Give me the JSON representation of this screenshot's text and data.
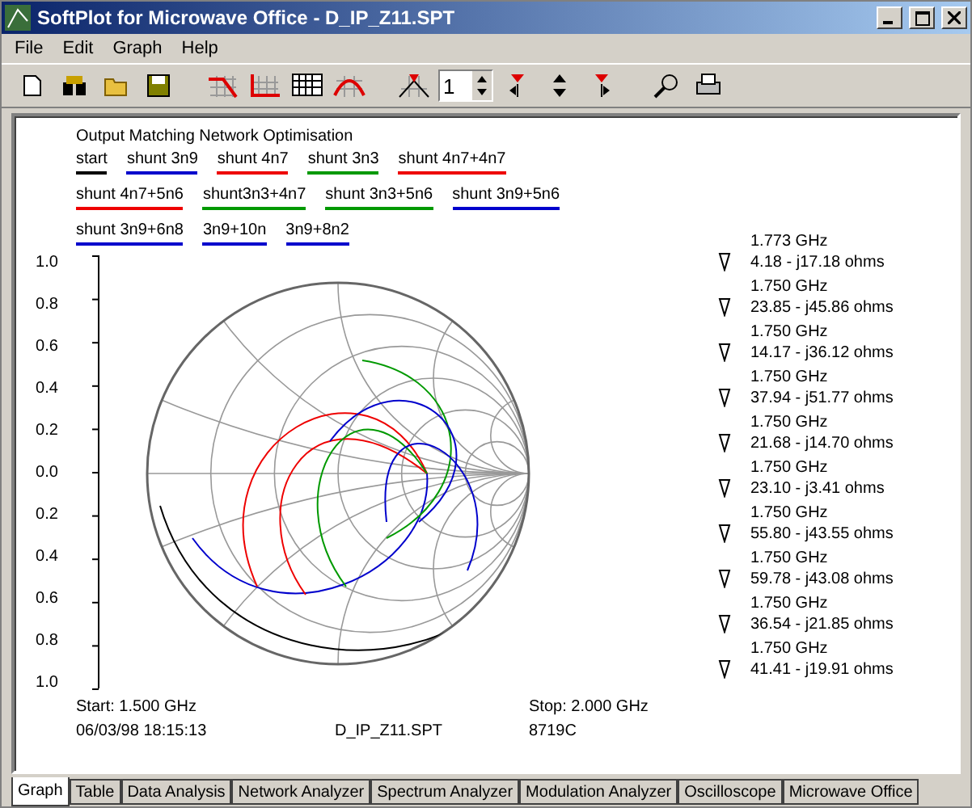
{
  "window": {
    "title": "SoftPlot for Microwave Office - D_IP_Z11.SPT"
  },
  "menu": [
    "File",
    "Edit",
    "Graph",
    "Help"
  ],
  "toolbar": {
    "spin_value": "1"
  },
  "plot": {
    "title": "Output Matching Network Optimisation",
    "legend": [
      [
        {
          "label": "start",
          "color": "#000000"
        },
        {
          "label": "shunt 3n9",
          "color": "#0000cc"
        },
        {
          "label": "shunt 4n7",
          "color": "#ee0000"
        },
        {
          "label": "shunt 3n3",
          "color": "#009900"
        },
        {
          "label": "shunt 4n7+4n7",
          "color": "#ee0000"
        }
      ],
      [
        {
          "label": "shunt 4n7+5n6",
          "color": "#ee0000"
        },
        {
          "label": "shunt3n3+4n7",
          "color": "#009900"
        },
        {
          "label": "shunt 3n3+5n6",
          "color": "#009900"
        },
        {
          "label": "shunt 3n9+5n6",
          "color": "#0000cc"
        }
      ],
      [
        {
          "label": "shunt 3n9+6n8",
          "color": "#0000cc"
        },
        {
          "label": "3n9+10n",
          "color": "#0000cc"
        },
        {
          "label": "3n9+8n2",
          "color": "#0000cc"
        }
      ]
    ],
    "y_ticks": [
      "1.0",
      "0.8",
      "0.6",
      "0.4",
      "0.2",
      "0.0",
      "0.2",
      "0.4",
      "0.6",
      "0.8",
      "1.0"
    ],
    "markers": [
      {
        "freq": "1.773 GHz",
        "value": "4.18 - j17.18 ohms"
      },
      {
        "freq": "1.750 GHz",
        "value": "23.85 - j45.86 ohms"
      },
      {
        "freq": "1.750 GHz",
        "value": "14.17 - j36.12 ohms"
      },
      {
        "freq": "1.750 GHz",
        "value": "37.94 - j51.77 ohms"
      },
      {
        "freq": "1.750 GHz",
        "value": "21.68 - j14.70 ohms"
      },
      {
        "freq": "1.750 GHz",
        "value": "23.10 - j3.41 ohms"
      },
      {
        "freq": "1.750 GHz",
        "value": "55.80 - j43.55 ohms"
      },
      {
        "freq": "1.750 GHz",
        "value": "59.78 - j43.08 ohms"
      },
      {
        "freq": "1.750 GHz",
        "value": "36.54 - j21.85 ohms"
      },
      {
        "freq": "1.750 GHz",
        "value": "41.41 - j19.91 ohms"
      }
    ],
    "start": "Start: 1.500 GHz",
    "stop": "Stop: 2.000 GHz",
    "date": "06/03/98 18:15:13",
    "file": "D_IP_Z11.SPT",
    "instrument": "8719C"
  },
  "tabs": [
    {
      "label": "Graph",
      "selected": true
    },
    {
      "label": "Table",
      "selected": false
    },
    {
      "label": "Data Analysis",
      "selected": false
    },
    {
      "label": "Network Analyzer",
      "selected": false
    },
    {
      "label": "Spectrum Analyzer",
      "selected": false
    },
    {
      "label": "Modulation Analyzer",
      "selected": false
    },
    {
      "label": "Oscilloscope",
      "selected": false
    },
    {
      "label": "Microwave Office",
      "selected": false
    }
  ]
}
